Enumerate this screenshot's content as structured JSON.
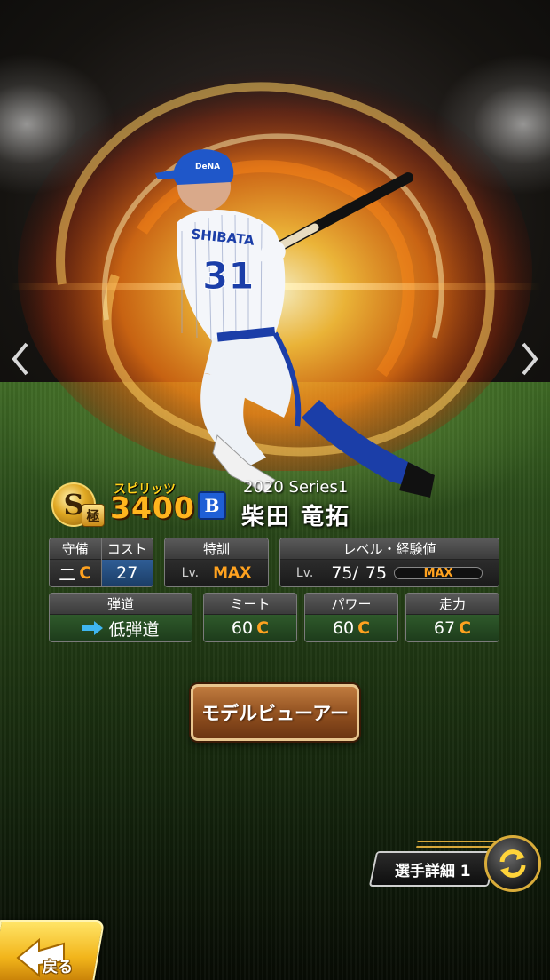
{
  "nav": {
    "prev_glyph": "‹",
    "next_glyph": "›"
  },
  "player": {
    "rank": "S",
    "rank_sub": "極",
    "spirits_label": "スピリッツ",
    "spirits_value": "3400",
    "team_logo": "B",
    "series": "2020 Series1",
    "name": "柴田 竜拓",
    "uniform_name": "SHIBATA",
    "uniform_number": "31",
    "helmet_text": "DeNA"
  },
  "stats": {
    "defense": {
      "label": "守備",
      "position": "二",
      "grade": "C"
    },
    "cost": {
      "label": "コスト",
      "value": "27"
    },
    "training": {
      "label": "特訓",
      "lv": "Lv.",
      "value": "MAX"
    },
    "level": {
      "label": "レベル・経験値",
      "lv": "Lv.",
      "current": "75",
      "sep": "/",
      "max": "75",
      "bar_text": "MAX",
      "exp_fraction": 1.0
    },
    "trajectory": {
      "label": "弾道",
      "value": "低弾道"
    },
    "meet": {
      "label": "ミート",
      "value": "60",
      "grade": "C"
    },
    "power": {
      "label": "パワー",
      "value": "60",
      "grade": "C"
    },
    "speed": {
      "label": "走力",
      "value": "67",
      "grade": "C"
    }
  },
  "buttons": {
    "model_viewer": "モデルビューアー",
    "player_detail": "選手詳細 1",
    "back": "戻る"
  },
  "colors": {
    "grade": "#ffa21f",
    "spirits": "#ffb51e",
    "team": "#1f5fd6",
    "back": "#f2b51b"
  }
}
